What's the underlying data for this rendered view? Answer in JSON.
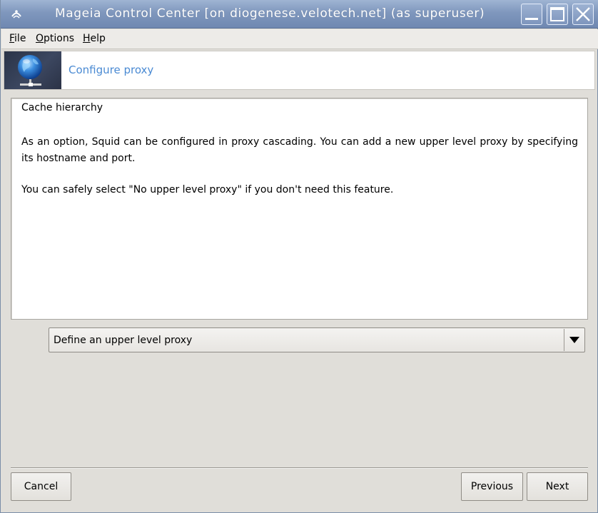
{
  "window": {
    "title": "Mageia Control Center  [on diogenese.velotech.net] (as superuser)"
  },
  "menu": {
    "file": "File",
    "options": "Options",
    "help": "Help"
  },
  "banner": {
    "title": "Configure proxy",
    "icon": "globe-network-icon"
  },
  "panel": {
    "heading": "Cache hierarchy",
    "paragraph1": "As an option, Squid can be configured in proxy cascading. You can add a new upper level proxy by specifying its hostname and port.",
    "paragraph2": "You can safely select \"No upper level proxy\" if you don't need this feature."
  },
  "combo": {
    "selected": "Define an upper level proxy"
  },
  "buttons": {
    "cancel": "Cancel",
    "previous": "Previous",
    "next": "Next"
  },
  "colors": {
    "titlebar": "#7f97bd",
    "banner_title": "#4a8ad3",
    "background": "#e0ded9"
  }
}
